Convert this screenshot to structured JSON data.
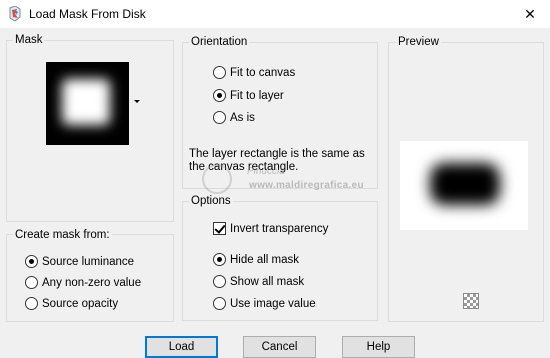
{
  "window": {
    "title": "Load Mask From Disk",
    "close_glyph": "✕"
  },
  "mask": {
    "label": "Mask"
  },
  "create_mask_from": {
    "label": "Create mask from:",
    "options": [
      {
        "label": "Source luminance",
        "checked": true
      },
      {
        "label": "Any non-zero value",
        "checked": false
      },
      {
        "label": "Source opacity",
        "checked": false
      }
    ]
  },
  "orientation": {
    "label": "Orientation",
    "options": [
      {
        "label": "Fit to canvas",
        "checked": false
      },
      {
        "label": "Fit to layer",
        "checked": true
      },
      {
        "label": "As is",
        "checked": false
      }
    ],
    "description": "The layer rectangle is the same as the canvas rectangle."
  },
  "options": {
    "label": "Options",
    "invert_transparency": {
      "label": "Invert transparency",
      "checked": true
    },
    "radios": [
      {
        "label": "Hide all mask",
        "checked": true
      },
      {
        "label": "Show all mask",
        "checked": false
      },
      {
        "label": "Use image value",
        "checked": false
      }
    ]
  },
  "preview": {
    "label": "Preview"
  },
  "buttons": {
    "load": "Load",
    "cancel": "Cancel",
    "help": "Help"
  },
  "watermark": {
    "line1": "Pinuccia",
    "line2": "www.maldiregrafica.eu"
  },
  "colors": {
    "window_bg": "#f0f0f0",
    "accent": "#0078d7",
    "titlebar": "#ffffff"
  }
}
